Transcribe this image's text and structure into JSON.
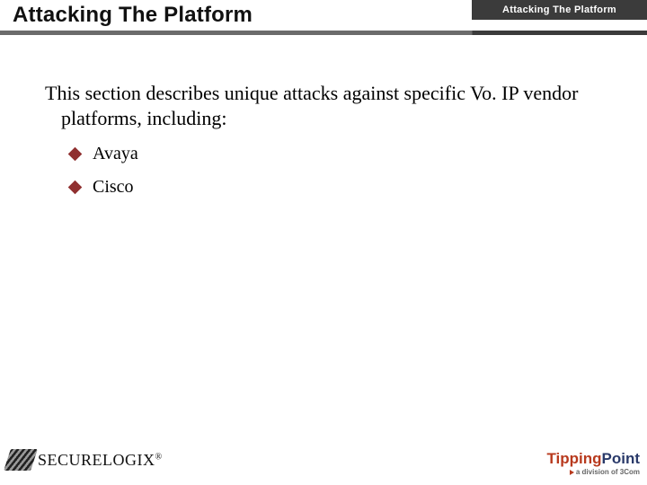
{
  "header": {
    "tab_label": "Attacking The Platform",
    "title": "Attacking The Platform"
  },
  "body": {
    "intro": "This section describes unique attacks against specific Vo. IP vendor platforms, including:",
    "bullets": [
      "Avaya",
      "Cisco"
    ]
  },
  "footer": {
    "left_logo_text": "SECURELOGIX",
    "left_logo_reg": "®",
    "right_logo_part1": "Tipping",
    "right_logo_part2": "Point",
    "right_logo_sub": "a division of 3Com"
  },
  "colors": {
    "bullet_diamond": "#903030",
    "header_dark": "#3b3b3b",
    "header_light": "#6b6b6b",
    "tipping": "#b83a1e",
    "point": "#2a3a6a"
  }
}
